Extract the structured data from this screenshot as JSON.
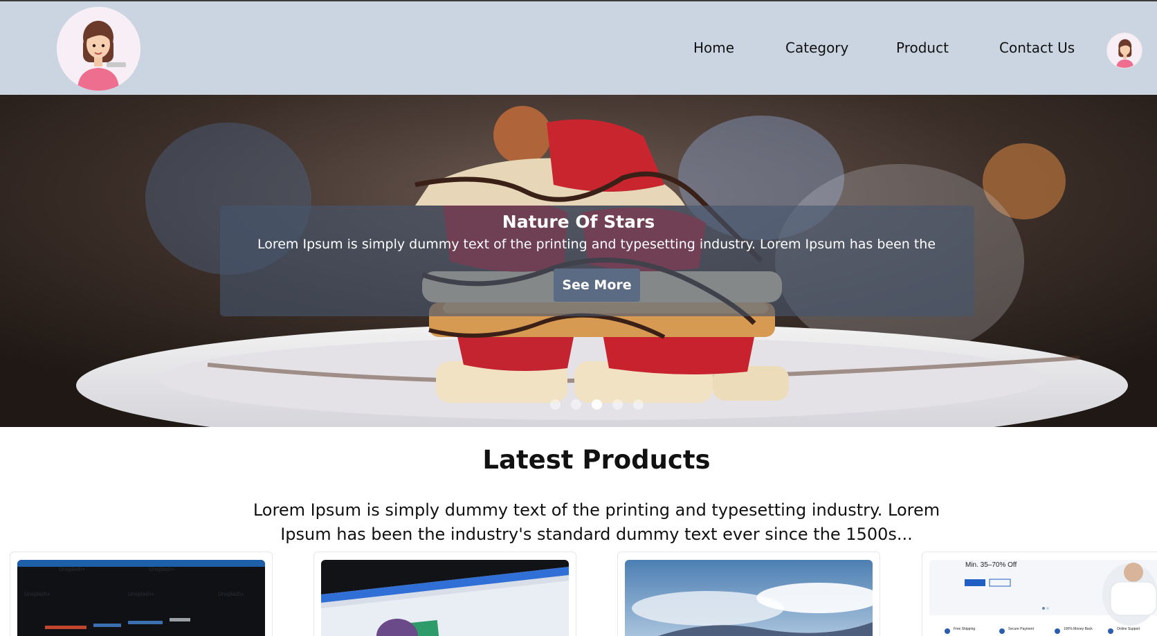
{
  "header": {
    "nav": [
      {
        "label": "Home"
      },
      {
        "label": "Category"
      },
      {
        "label": "Product"
      },
      {
        "label": "Contact Us"
      }
    ],
    "logo_icon": "girl-avatar-icon",
    "profile_icon": "user-avatar-icon"
  },
  "hero": {
    "title": "Nature Of Stars",
    "text": "Lorem Ipsum is simply dummy text of the printing and typesetting industry. Lorem Ipsum has been the",
    "button_label": "See More",
    "slides_total": 5,
    "active_slide": 3
  },
  "latest": {
    "title": "Latest Products",
    "text": "Lorem Ipsum is simply dummy text of the printing and typesetting industry. Lorem Ipsum has been the industry's standard dummy text ever since the 1500s..."
  },
  "cards": [
    {
      "image": "code-screen-image"
    },
    {
      "image": "laptop-screen-image"
    },
    {
      "image": "sky-clouds-image"
    },
    {
      "image": "store-banner-image",
      "banner_text": "Min. 35–70% Off",
      "features": [
        "Free Shipping",
        "Secure Payment",
        "100% Money Back",
        "Online Support"
      ]
    }
  ],
  "colors": {
    "header_bg": "#cbd5e1",
    "caption_bg": "#46556e",
    "button_bg": "#5b6b84"
  }
}
